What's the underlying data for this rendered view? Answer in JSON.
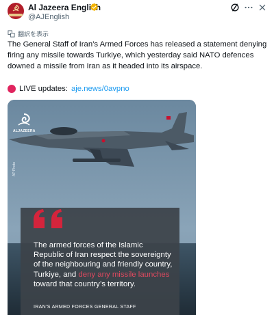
{
  "account": {
    "name": "Al Jazeera English",
    "handle": "@AJEnglish",
    "avatar_icon": "al-jazeera-logo-icon",
    "verified_icon": "verified-badge-icon",
    "verified_color": "#f4b400"
  },
  "header_actions": {
    "grok_icon": "grok-icon",
    "more_icon": "more-dots-icon",
    "close_icon": "close-icon"
  },
  "translate": {
    "label": "翻訳を表示",
    "icon": "translate-icon"
  },
  "tweet": {
    "text": "The General Staff of Iran’s Armed Forces has released a statement denying firing any missile towards Turkiye, which yesterday said NATO defences downed a missile from Iran as it headed into its airspace.",
    "live_label": "LIVE updates:",
    "live_link": "aje.news/0avpno",
    "live_icon": "red-circle-icon",
    "link_color": "#1d9bf0"
  },
  "media": {
    "logo_text": "ALJAZEERA",
    "photo_credit": "AP Photo",
    "quote_icon": "quote-mark-icon",
    "quote_color": "#d4243c",
    "quote_part1": "The armed forces of the Islamic Republic of Iran respect the sovereignty of the neighbouring and friendly country, Turkiye, and ",
    "quote_highlight": "deny any missile launches",
    "quote_part2": " toward that country’s territory.",
    "source": "IRAN’S ARMED FORCES GENERAL STAFF"
  }
}
